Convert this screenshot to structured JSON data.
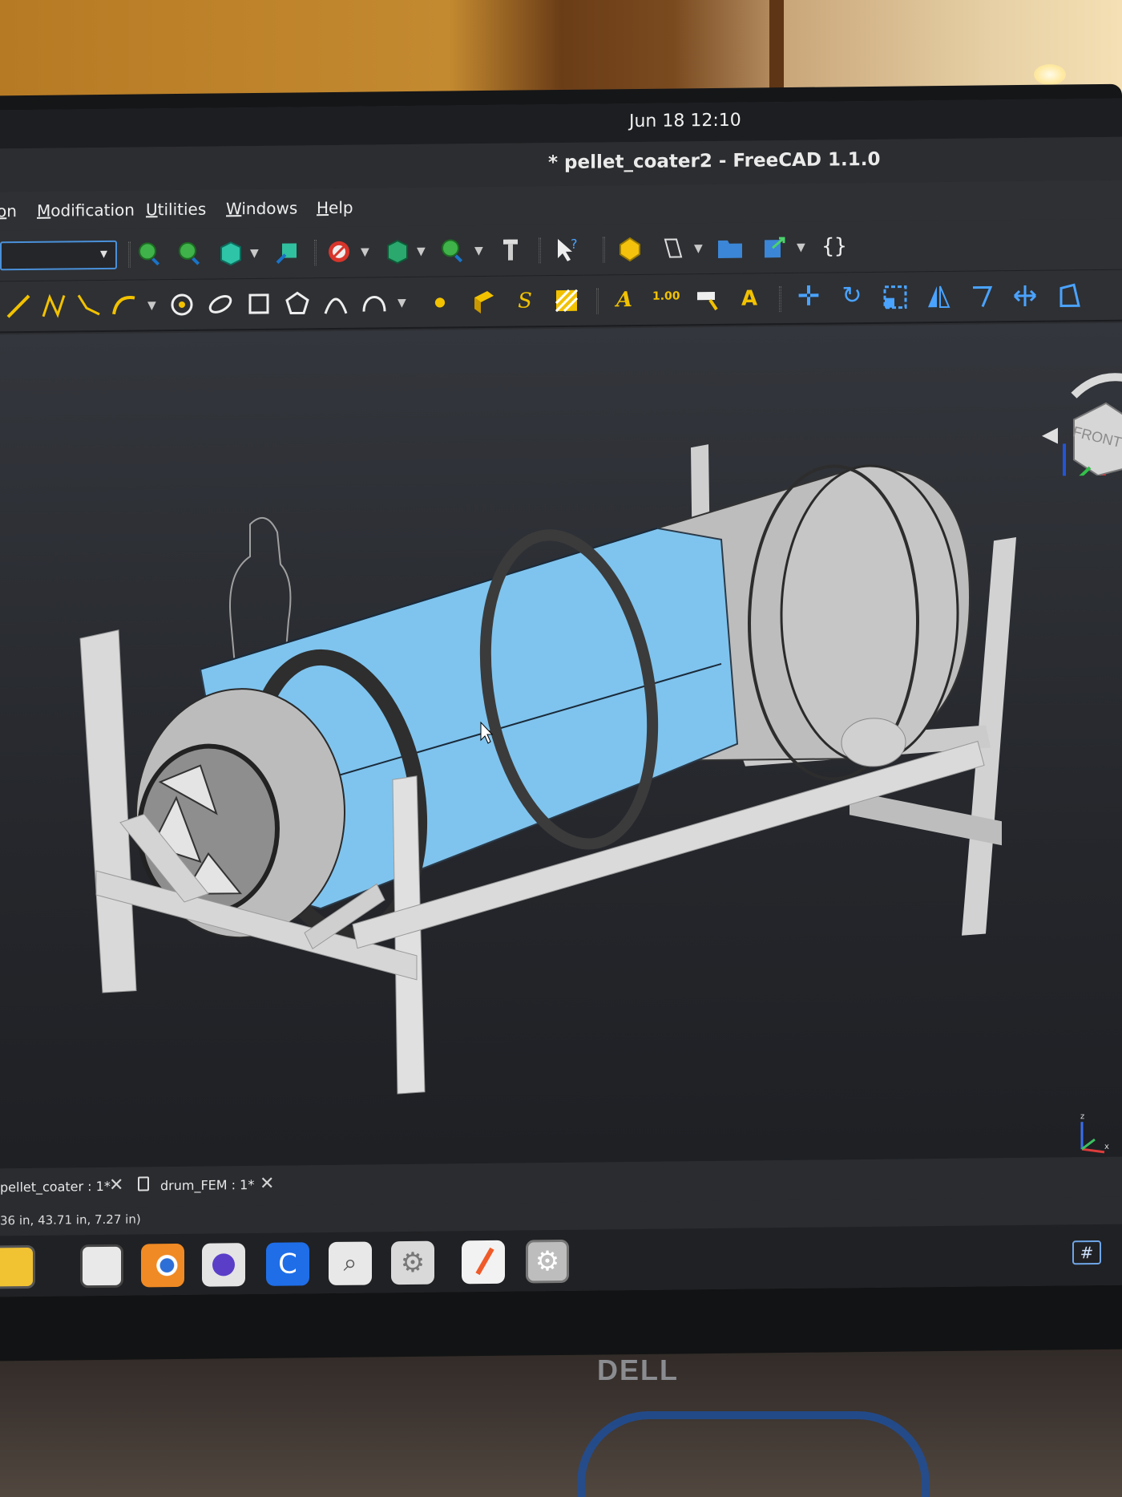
{
  "topbar": {
    "clock": "Jun 18  12:10"
  },
  "window": {
    "title": "* pellet_coater2 - FreeCAD 1.1.0"
  },
  "menubar": {
    "items": [
      "on",
      "Modification",
      "Utilities",
      "Windows",
      "Help"
    ]
  },
  "navcube": {
    "face_label": "FRONT"
  },
  "tabs": [
    {
      "label": "pellet_coater : 1*"
    },
    {
      "label": "drum_FEM : 1*"
    }
  ],
  "status": {
    "coordinates": "36 in, 43.71 in, 7.27 in)"
  },
  "icons": {
    "toolbar1": [
      "zoom-fit-icon",
      "zoom-selection-icon",
      "view-cube-icon",
      "view-axo-icon",
      "draw-style-icon",
      "std-view-icon",
      "zoom-icon",
      "measure-icon",
      "whats-this-icon",
      "part-icon",
      "new-sketch-icon",
      "open-folder-icon",
      "export-icon",
      "macro-icon"
    ],
    "toolbar2": [
      "line-icon",
      "polyline-icon",
      "fillet-icon",
      "arc-icon",
      "circle-icon",
      "ellipse-icon",
      "rectangle-icon",
      "polygon-icon",
      "bspline-icon",
      "bezier-icon",
      "point-icon",
      "facebinder-icon",
      "shapestring-icon",
      "hatch-icon",
      "text-icon",
      "dimension-icon",
      "label-icon",
      "annotation-style-icon",
      "move-icon",
      "rotate-icon",
      "scale-icon",
      "mirror-icon",
      "offset-icon",
      "stretch-icon",
      "trimex-icon"
    ],
    "dock": [
      "calculator-icon",
      "text-editor-icon",
      "blender-icon",
      "screenshot-icon",
      "c-editor-icon",
      "image-viewer-icon",
      "settings-icon",
      "drawing-icon",
      "freecad-icon"
    ]
  },
  "colors": {
    "drum_selected": "#7fc4ee",
    "drum_body": "#c9c9c9",
    "frame": "#d6d6d6",
    "background_top": "#33363c",
    "accent": "#4a90d9"
  },
  "brand": {
    "monitor": "DELL"
  }
}
